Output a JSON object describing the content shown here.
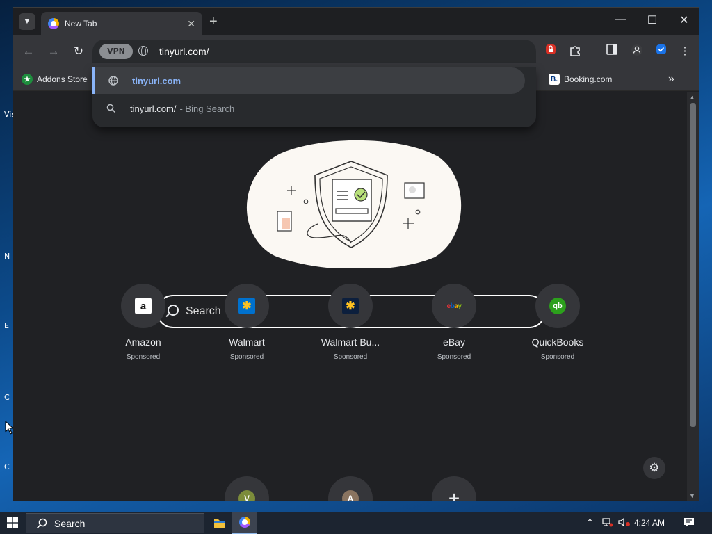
{
  "browser": {
    "tab": {
      "title": "New Tab"
    },
    "omnibox": {
      "vpn_label": "VPN",
      "value": "tinyurl.com/"
    },
    "bookmarks": [
      {
        "label": "Addons Store"
      },
      {
        "label": "Booking.com"
      }
    ],
    "suggestions": [
      {
        "primary": "tinyurl.com",
        "secondary": ""
      },
      {
        "primary": "tinyurl.com/",
        "secondary": "- Bing Search"
      }
    ]
  },
  "newtab": {
    "search_placeholder": "Search",
    "tiles": [
      {
        "name": "Amazon",
        "sponsored": "Sponsored",
        "icon": "amazon-icon"
      },
      {
        "name": "Walmart",
        "sponsored": "Sponsored",
        "icon": "walmart-icon"
      },
      {
        "name": "Walmart Bu...",
        "sponsored": "Sponsored",
        "icon": "walmart-business-icon"
      },
      {
        "name": "eBay",
        "sponsored": "Sponsored",
        "icon": "ebay-icon"
      },
      {
        "name": "QuickBooks",
        "sponsored": "Sponsored",
        "icon": "quickbooks-icon"
      }
    ],
    "tiles_row2": [
      {
        "letter": "V"
      },
      {
        "letter": "A"
      }
    ]
  },
  "taskbar": {
    "search_placeholder": "Search",
    "time": "4:24 AM"
  },
  "colors": {
    "accent": "#8ab4f8",
    "amazon": "#ffffff",
    "walmart": "#0071ce",
    "walmart_spark": "#ffc220",
    "quickbooks": "#2ca01c"
  }
}
